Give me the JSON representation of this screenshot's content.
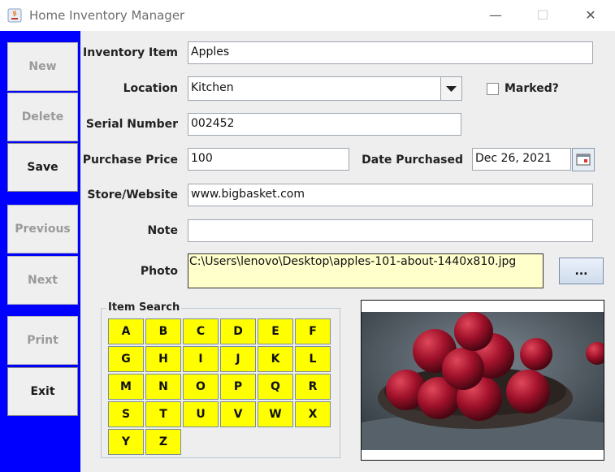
{
  "window": {
    "title": "Home Inventory Manager",
    "minimize_glyph": "—",
    "maximize_glyph": "☐",
    "close_glyph": "✕"
  },
  "sidebar": {
    "new": "New",
    "delete": "Delete",
    "save": "Save",
    "previous": "Previous",
    "next": "Next",
    "print": "Print",
    "exit": "Exit"
  },
  "form": {
    "inventory_item_label": "Inventory Item",
    "inventory_item_value": "Apples",
    "location_label": "Location",
    "location_value": "Kitchen",
    "marked_label": "Marked?",
    "marked_checked": false,
    "serial_label": "Serial Number",
    "serial_value": "002452",
    "price_label": "Purchase Price",
    "price_value": "100",
    "date_label": "Date Purchased",
    "date_value": "Dec 26, 2021",
    "store_label": "Store/Website",
    "store_value": "www.bigbasket.com",
    "note_label": "Note",
    "note_value": "",
    "photo_label": "Photo",
    "photo_path": "C:\\Users\\lenovo\\Desktop\\apples-101-about-1440x810.jpg",
    "browse_label": "..."
  },
  "item_search": {
    "title": "Item Search",
    "letters": [
      "A",
      "B",
      "C",
      "D",
      "E",
      "F",
      "G",
      "H",
      "I",
      "J",
      "K",
      "L",
      "M",
      "N",
      "O",
      "P",
      "Q",
      "R",
      "S",
      "T",
      "U",
      "V",
      "W",
      "X",
      "Y",
      "Z"
    ]
  },
  "colors": {
    "sidebar": "#0000ff",
    "letter_button": "#ffff00",
    "photo_field": "#ffffcc"
  }
}
